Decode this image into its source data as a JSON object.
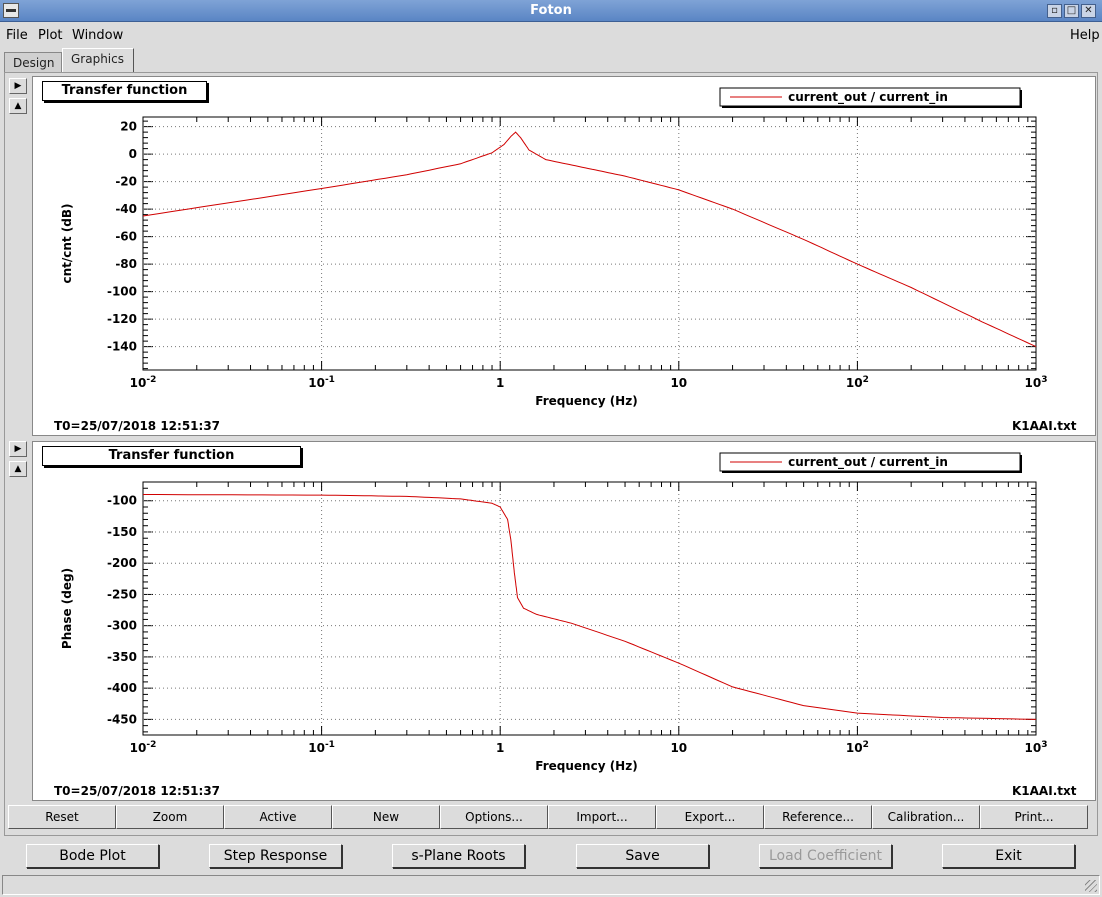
{
  "window": {
    "title": "Foton"
  },
  "menu": {
    "file": "File",
    "plot": "Plot",
    "window": "Window",
    "help": "Help"
  },
  "tabs": [
    {
      "label": "Design"
    },
    {
      "label": "Graphics"
    }
  ],
  "plots": [
    {
      "title": "Transfer function",
      "legend": "current_out / current_in",
      "timestamp": "T0=25/07/2018 12:51:37",
      "filename": "K1AAI.txt"
    },
    {
      "title": "Transfer function",
      "legend": "current_out / current_in",
      "timestamp": "T0=25/07/2018 12:51:37",
      "filename": "K1AAI.txt"
    }
  ],
  "toolbar": [
    "Reset",
    "Zoom",
    "Active",
    "New",
    "Options...",
    "Import...",
    "Export...",
    "Reference...",
    "Calibration...",
    "Print..."
  ],
  "actions": {
    "bode": "Bode Plot",
    "step": "Step Response",
    "splane": "s-Plane Roots",
    "save": "Save",
    "load": "Load Coefficient",
    "exit": "Exit"
  },
  "chart_data": [
    {
      "type": "line",
      "title": "Transfer function",
      "xlabel": "Frequency (Hz)",
      "ylabel": "cnt/cnt (dB)",
      "xscale": "log",
      "xlim": [
        0.01,
        1000
      ],
      "ylim": [
        -157,
        27
      ],
      "x_ticks": [
        "10^-2",
        "10^-1",
        "1",
        "10",
        "10^2",
        "10^3"
      ],
      "y_ticks": [
        20,
        0,
        -20,
        -40,
        -60,
        -80,
        -100,
        -120,
        -140
      ],
      "grid": true,
      "legend_position": "top-right",
      "color": "#d00000",
      "series": [
        {
          "name": "current_out / current_in",
          "x": [
            0.01,
            0.1,
            0.3,
            0.6,
            0.9,
            1.05,
            1.15,
            1.22,
            1.3,
            1.45,
            1.8,
            3,
            5,
            10,
            20,
            50,
            100,
            200,
            500,
            1000
          ],
          "y": [
            -45,
            -25,
            -15,
            -7,
            1,
            7,
            13,
            16,
            12,
            3,
            -4,
            -10,
            -16,
            -26,
            -40,
            -62,
            -80,
            -97,
            -122,
            -140
          ]
        }
      ]
    },
    {
      "type": "line",
      "title": "Transfer function",
      "xlabel": "Frequency (Hz)",
      "ylabel": "Phase (deg)",
      "xscale": "log",
      "xlim": [
        0.01,
        1000
      ],
      "ylim": [
        -475,
        -70
      ],
      "x_ticks": [
        "10^-2",
        "10^-1",
        "1",
        "10",
        "10^2",
        "10^3"
      ],
      "y_ticks": [
        -100,
        -150,
        -200,
        -250,
        -300,
        -350,
        -400,
        -450
      ],
      "grid": true,
      "legend_position": "top-right",
      "color": "#d00000",
      "series": [
        {
          "name": "current_out / current_in",
          "x": [
            0.01,
            0.1,
            0.3,
            0.6,
            0.9,
            1.0,
            1.1,
            1.15,
            1.2,
            1.25,
            1.35,
            1.6,
            2.5,
            5,
            10,
            20,
            50,
            100,
            300,
            1000
          ],
          "y": [
            -90,
            -91,
            -93,
            -97,
            -104,
            -110,
            -130,
            -165,
            -215,
            -255,
            -272,
            -282,
            -296,
            -325,
            -360,
            -398,
            -428,
            -440,
            -447,
            -450
          ]
        }
      ]
    }
  ]
}
